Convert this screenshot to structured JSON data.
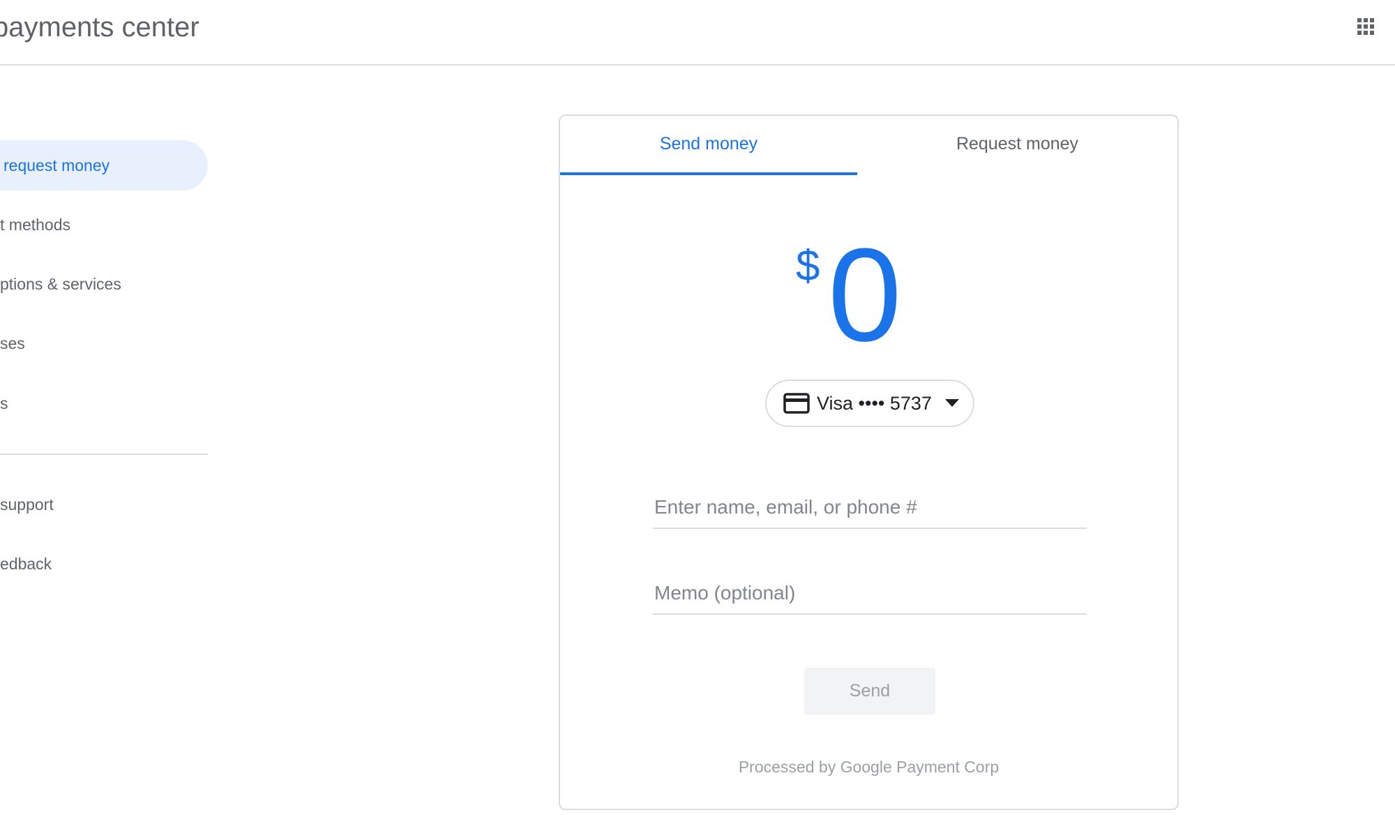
{
  "header": {
    "title": "payments center",
    "apps_icon": "apps-grid-icon"
  },
  "sidebar": {
    "items": [
      {
        "label": "request money",
        "active": true
      },
      {
        "label": "t methods",
        "active": false
      },
      {
        "label": "ptions & services",
        "active": false
      },
      {
        "label": "ses",
        "active": false
      },
      {
        "label": "s",
        "active": false
      }
    ],
    "secondary_items": [
      {
        "label": "support"
      },
      {
        "label": "edback"
      }
    ]
  },
  "tabs": [
    {
      "label": "Send money",
      "selected": true
    },
    {
      "label": "Request money",
      "selected": false
    }
  ],
  "amount": {
    "currency": "$",
    "value": "0"
  },
  "payment_method": {
    "label": "Visa •••• 5737",
    "icon": "credit-card-icon"
  },
  "form": {
    "recipient_placeholder": "Enter name, email, or phone #",
    "memo_placeholder": "Memo (optional)",
    "send_label": "Send"
  },
  "footer_note": "Processed by Google Payment Corp",
  "colors": {
    "accent": "#1a73e8",
    "active_nav_bg": "#e8f0fe",
    "divider": "#dadce0"
  }
}
